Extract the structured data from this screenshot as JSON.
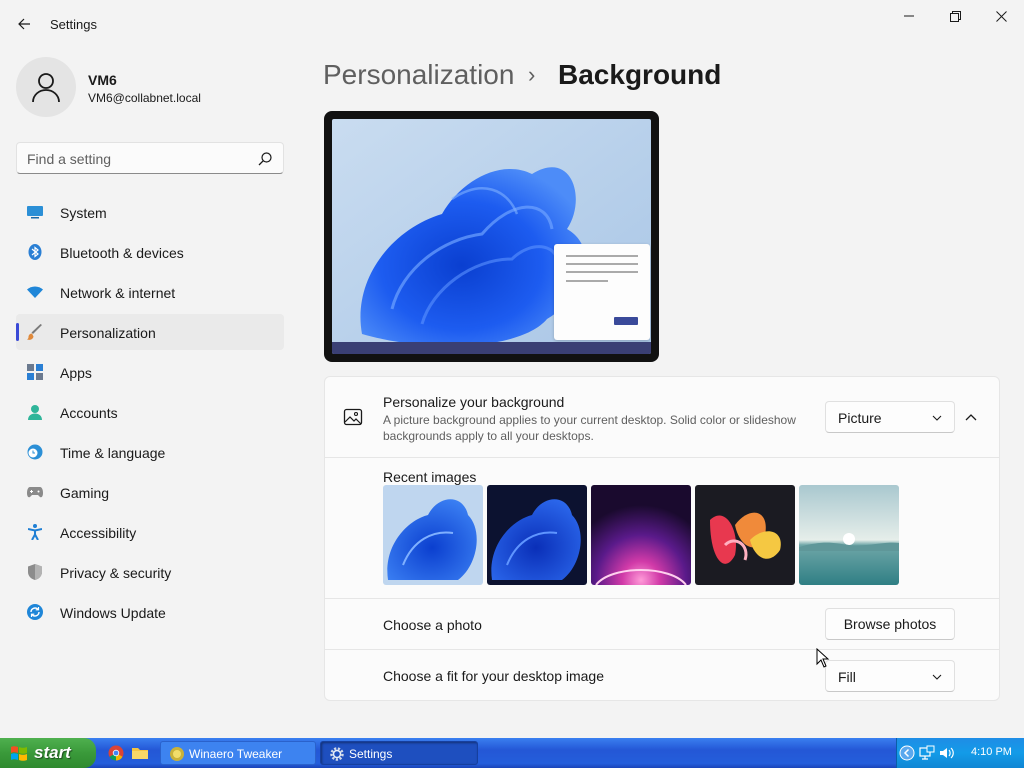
{
  "window": {
    "title": "Settings",
    "back_icon": "arrow-left-icon",
    "controls": [
      "minimize-icon",
      "maximize-icon",
      "close-icon"
    ]
  },
  "profile": {
    "name": "VM6",
    "email": "VM6@collabnet.local"
  },
  "search": {
    "placeholder": "Find a setting",
    "value": ""
  },
  "nav": {
    "items": [
      {
        "label": "System",
        "icon": "system-icon",
        "active": false
      },
      {
        "label": "Bluetooth & devices",
        "icon": "bluetooth-icon",
        "active": false
      },
      {
        "label": "Network & internet",
        "icon": "wifi-icon",
        "active": false
      },
      {
        "label": "Personalization",
        "icon": "brush-icon",
        "active": true
      },
      {
        "label": "Apps",
        "icon": "apps-icon",
        "active": false
      },
      {
        "label": "Accounts",
        "icon": "accounts-icon",
        "active": false
      },
      {
        "label": "Time & language",
        "icon": "clock-globe-icon",
        "active": false
      },
      {
        "label": "Gaming",
        "icon": "gamepad-icon",
        "active": false
      },
      {
        "label": "Accessibility",
        "icon": "accessibility-icon",
        "active": false
      },
      {
        "label": "Privacy & security",
        "icon": "shield-icon",
        "active": false
      },
      {
        "label": "Windows Update",
        "icon": "update-icon",
        "active": false
      }
    ]
  },
  "breadcrumb": {
    "parent": "Personalization",
    "separator": "›",
    "current": "Background"
  },
  "background": {
    "title": "Personalize your background",
    "description": "A picture background applies to your current desktop. Solid color or slideshow backgrounds apply to all your desktops.",
    "type_value": "Picture",
    "recent_label": "Recent images",
    "recent_images": [
      "bloom-light-blue",
      "bloom-dark-blue",
      "purple-glow",
      "colorful-ribbons",
      "lake-sunrise"
    ],
    "choose_photo_label": "Choose a photo",
    "browse_label": "Browse photos",
    "fit_label": "Choose a fit for your desktop image",
    "fit_value": "Fill"
  },
  "taskbar": {
    "start_label": "start",
    "quick_launch": [
      "chrome-icon",
      "folder-icon"
    ],
    "tasks": [
      {
        "label": "Winaero Tweaker",
        "icon": "winaero-icon",
        "active": false
      },
      {
        "label": "Settings",
        "icon": "gear-icon",
        "active": true
      }
    ],
    "tray_icons": [
      "chevron-left-icon",
      "network-icon",
      "volume-icon"
    ],
    "clock": "4:10 PM"
  },
  "colors": {
    "accent": "#3a4ad6",
    "window_bg": "#f3f3f3",
    "card_bg": "#fbfbfb",
    "taskbar_blue": "#245edb",
    "start_green": "#3a9a3a"
  }
}
